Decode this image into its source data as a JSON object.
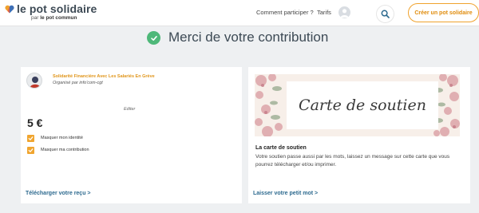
{
  "header": {
    "logo_title": "le pot solidaire",
    "logo_sub_prefix": "par",
    "logo_sub_brand": "le pot commun",
    "nav": [
      "Comment participer ?",
      "Tarifs"
    ],
    "create_label": "Créer un pot solidaire"
  },
  "page": {
    "title": "Merci de votre contribution"
  },
  "contribution": {
    "org_name": "Solidarité Financière Avec Les Salariés En Grève",
    "organizer": "Organisé par info'com-cgt",
    "edit_label": "Editer",
    "amount": "5 €",
    "options": [
      {
        "label": "Masquer mon identité",
        "checked": true
      },
      {
        "label": "Masquer ma contribution",
        "checked": true
      }
    ],
    "receipt_link": "Télécharger votre reçu >"
  },
  "support_card": {
    "banner_text": "Carte de soutien",
    "title": "La carte de soutien",
    "description": "Votre soutien passe aussi par les mots, laissez un message sur cette carte que vous pourrez télécharger et/ou imprimer.",
    "link": "Laisser votre petit mot >"
  },
  "colors": {
    "accent": "#f0a22d",
    "success": "#4eb879",
    "link": "#2d6a8f",
    "background": "#eef0f2"
  },
  "icons": [
    "heart-logo-icon",
    "user-avatar-icon",
    "search-icon",
    "check-circle-icon",
    "checkbox-checked-icon"
  ]
}
